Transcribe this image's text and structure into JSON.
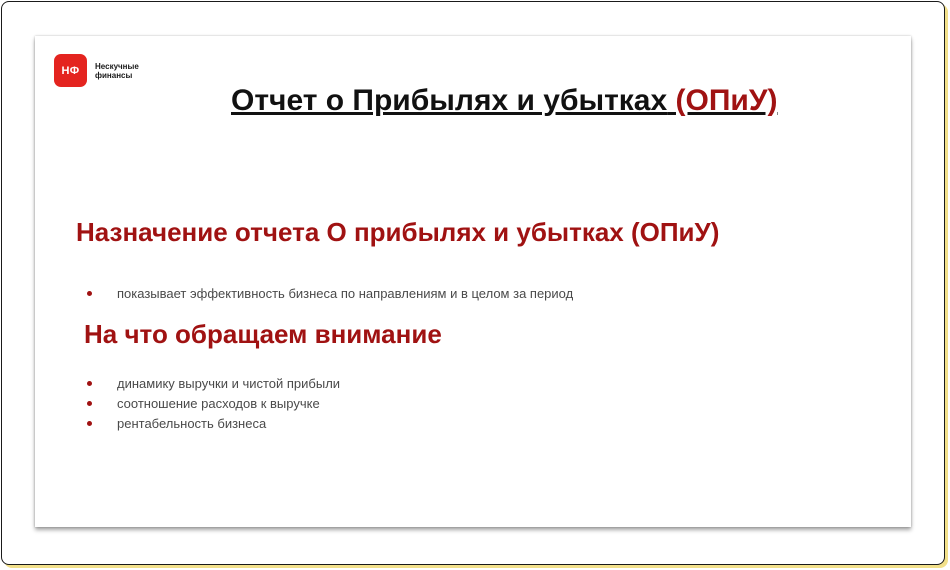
{
  "logo": {
    "mark": "НФ",
    "name": "Нескучные финансы"
  },
  "title": {
    "main": "Отчет о Прибылях и убытках",
    "accent": "(ОПиУ)"
  },
  "section_purpose": {
    "heading": "Назначение отчета О прибылях и убытках (ОПиУ)",
    "items": [
      "показывает эффективность бизнеса по направлениям и в целом за период"
    ]
  },
  "section_focus": {
    "heading": "На что обращаем внимание",
    "items": [
      "динамику выручки и чистой прибыли",
      "соотношение расходов к выручке",
      "рентабельность бизнеса"
    ]
  },
  "colors": {
    "accent": "#a01212",
    "logo": "#e4241f"
  }
}
